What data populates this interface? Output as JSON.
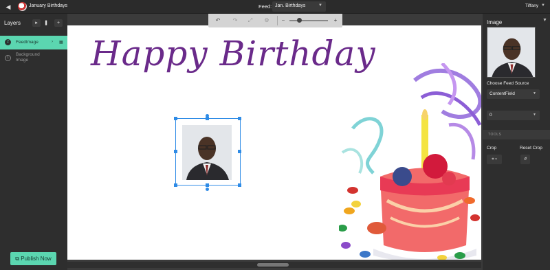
{
  "app": {
    "title": "January Birthdays"
  },
  "feed": {
    "label": "Feed:",
    "selected": "Jan. Birthdays"
  },
  "user": {
    "name": "Tiffany"
  },
  "layers": {
    "title": "Layers",
    "items": [
      {
        "num": "2",
        "label": "FeedImage",
        "selected": true
      },
      {
        "num": "1",
        "label": "Background Image",
        "selected": false
      }
    ]
  },
  "publish": {
    "label": "Publish Now"
  },
  "canvas": {
    "heading": "Happy Birthday"
  },
  "toolbar": {
    "zoom_minus": "−",
    "zoom_plus": "+",
    "zoom_level": 0.25
  },
  "panel": {
    "title": "Image",
    "feed_source_label": "Choose Feed Source",
    "feed_source_value": "ContentField",
    "index_value": "0",
    "tools_label": "TOOLS",
    "crop_label": "Crop",
    "reset_crop_label": "Reset Crop"
  },
  "colors": {
    "accent": "#5bd6b0",
    "heading": "#6a2a8a",
    "selection": "#2e8be6"
  }
}
